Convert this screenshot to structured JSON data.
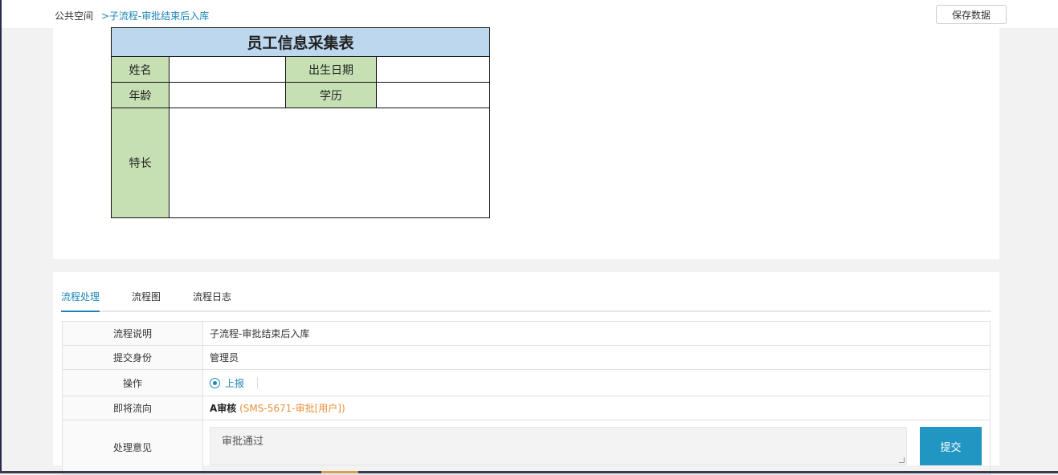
{
  "breadcrumb": {
    "root": "公共空间",
    "separator": ">",
    "current": "子流程-审批结束后入库"
  },
  "toolbar": {
    "save_label": "保存数据"
  },
  "form": {
    "title": "员工信息采集表",
    "fields": {
      "name_label": "姓名",
      "birth_label": "出生日期",
      "age_label": "年龄",
      "education_label": "学历",
      "specialty_label": "特长"
    }
  },
  "tabs": [
    {
      "label": "流程处理",
      "active": true
    },
    {
      "label": "流程图",
      "active": false
    },
    {
      "label": "流程日志",
      "active": false
    }
  ],
  "process": {
    "description_label": "流程说明",
    "description_value": "子流程-审批结束后入库",
    "identity_label": "提交身份",
    "identity_value": "管理员",
    "action_label": "操作",
    "action_option": "上报",
    "next_label": "即将流向",
    "next_node": "A审核",
    "next_detail": "(SMS-5671-审批[用户])",
    "opinion_label": "处理意见",
    "opinion_value": "审批通过",
    "submit_label": "提交"
  },
  "colors": {
    "accent": "#1e86b7",
    "submit": "#2196c3",
    "header_fill": "#bdd7ee",
    "label_fill": "#c6e0b4",
    "next_detail": "#e8913a"
  }
}
